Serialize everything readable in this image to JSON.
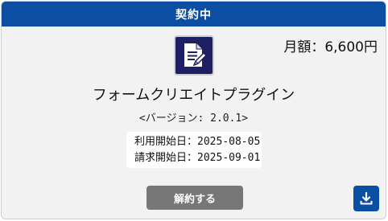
{
  "header": {
    "status": "契約中"
  },
  "price": {
    "label": "月額：6,600円"
  },
  "plugin": {
    "icon": "document-edit-icon",
    "name": "フォームクリエイトプラグイン",
    "version": "<バージョン: 2.0.1>"
  },
  "dates": {
    "start_label": "利用開始日：",
    "start_value": "2025-08-05",
    "billing_label": "請求開始日：",
    "billing_value": "2025-09-01"
  },
  "actions": {
    "cancel_label": "解約する",
    "download_icon": "download-icon"
  },
  "colors": {
    "header_bg": "#0b4ea2",
    "cancel_bg": "#777777",
    "icon_bg": "#1f1f63"
  }
}
